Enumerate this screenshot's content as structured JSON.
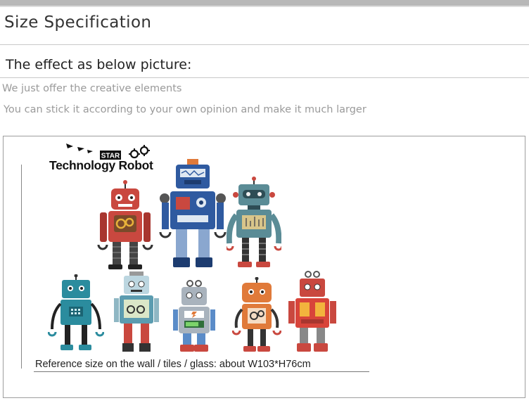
{
  "section_title": "Size Specification",
  "effect_heading": "The effect as below picture:",
  "notes": [
    "We just offer the creative elements",
    "You can stick it according to your own opinion and make it much larger"
  ],
  "product_logo": {
    "badge": "STAR",
    "title": "Technology Robot"
  },
  "reference_size": "Reference size on the wall / tiles / glass: about  W103*H76cm",
  "colors": {
    "red_robot": "#c9483f",
    "blue_robot": "#2f5aa0",
    "teal_robot": "#5b8c96",
    "cyan_robot": "#2b8c9e",
    "orange_robot": "#e07a3a"
  }
}
